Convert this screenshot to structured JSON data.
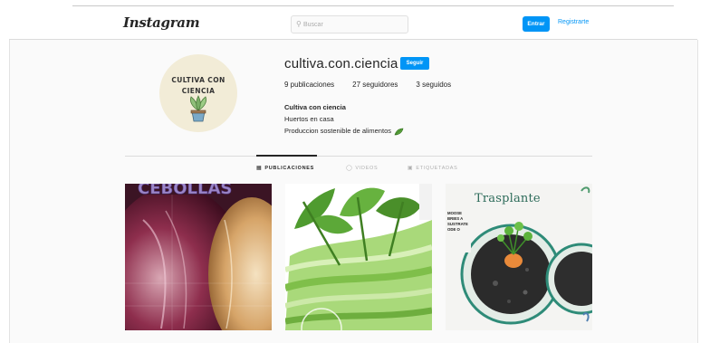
{
  "header": {
    "logo": "Instagram",
    "search_placeholder": "Buscar",
    "login_label": "Entrar",
    "signup_label": "Registrarte"
  },
  "profile": {
    "avatar_line1": "CULTIVA CON",
    "avatar_line2": "CIENCIA",
    "username": "cultiva.con.ciencia",
    "follow_label": "Seguir",
    "stats": {
      "posts": "9 publicaciones",
      "followers": "27 seguidores",
      "following": "3 seguidos"
    },
    "bio": {
      "name": "Cultiva con ciencia",
      "line1": "Huertos en casa",
      "line2": "Produccion sostenible de alimentos"
    }
  },
  "tabs": [
    {
      "label": "PUBLICACIONES",
      "icon": "grid-icon",
      "active": true
    },
    {
      "label": "VIDEOS",
      "icon": "video-icon",
      "active": false
    },
    {
      "label": "ETIQUETADAS",
      "icon": "tag-icon",
      "active": false
    }
  ],
  "posts": [
    {
      "overlay_text": "CEBOLLAS",
      "subject": "red-and-white-onions"
    },
    {
      "overlay_text": "",
      "subject": "celery-stalks"
    },
    {
      "overlay_text": "Trasplante",
      "side_text": "MOOSE BRIES A SUSTRATE ODE O",
      "subject": "carrot-top-in-pot"
    }
  ],
  "colors": {
    "accent": "#0095f6",
    "background": "#fafafa",
    "avatar_bg": "#f2ecd7"
  }
}
